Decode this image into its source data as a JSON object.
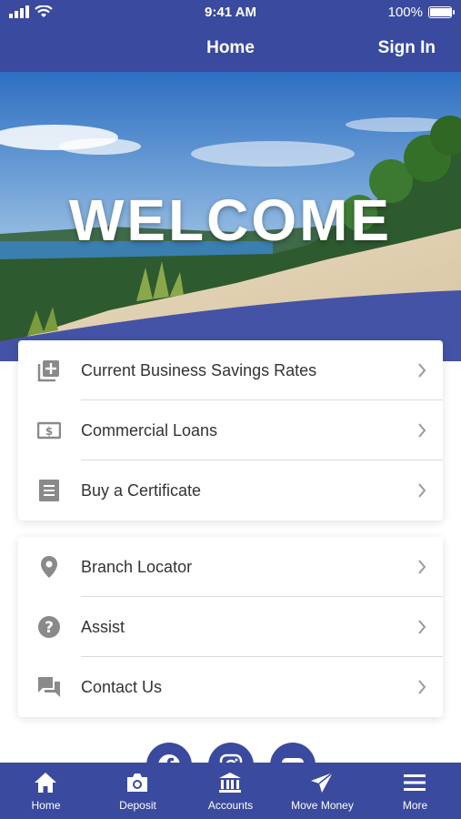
{
  "status_bar": {
    "time": "9:41 AM",
    "battery": "100%",
    "battery_level": 1.0
  },
  "nav": {
    "title": "Home",
    "sign_in": "Sign In"
  },
  "hero": {
    "welcome": "WELCOME"
  },
  "menu_group_1": [
    {
      "label": "Current Business Savings Rates",
      "icon": "add-box-icon"
    },
    {
      "label": "Commercial Loans",
      "icon": "dollar-bill-icon"
    },
    {
      "label": "Buy a Certificate",
      "icon": "certificate-icon"
    }
  ],
  "menu_group_2": [
    {
      "label": "Branch Locator",
      "icon": "location-pin-icon"
    },
    {
      "label": "Assist",
      "icon": "help-icon"
    },
    {
      "label": "Contact Us",
      "icon": "chat-icon"
    }
  ],
  "social": [
    "facebook-icon",
    "instagram-icon",
    "youtube-icon"
  ],
  "tab_bar": {
    "items": [
      {
        "label": "Home",
        "icon": "home-icon"
      },
      {
        "label": "Deposit",
        "icon": "camera-icon"
      },
      {
        "label": "Accounts",
        "icon": "bank-icon"
      },
      {
        "label": "Move Money",
        "icon": "send-icon"
      },
      {
        "label": "More",
        "icon": "menu-icon"
      }
    ]
  },
  "colors": {
    "brand": "#3a4a9e",
    "icon_gray": "#8a8a8a",
    "text": "#333333"
  }
}
